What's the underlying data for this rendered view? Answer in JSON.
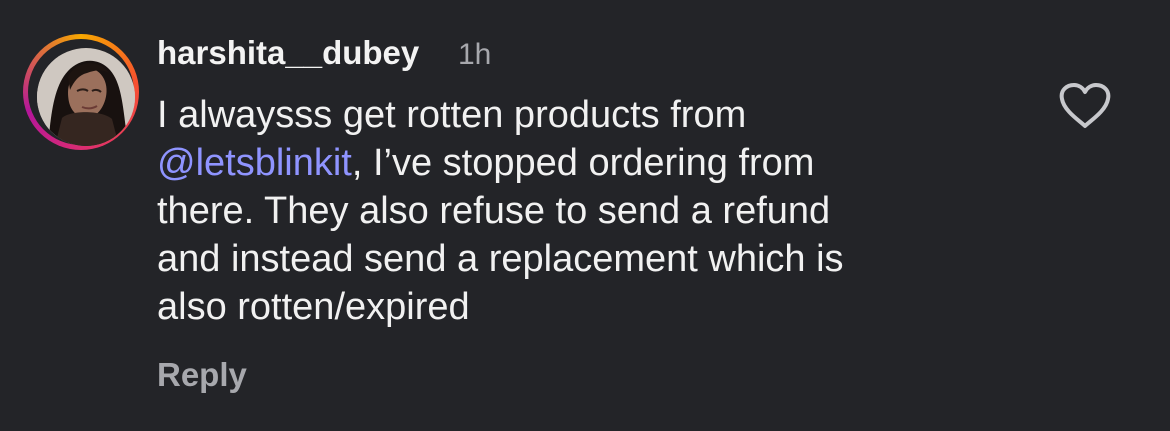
{
  "comment": {
    "username": "harshita__dubey",
    "time": "1h",
    "text_before_mention": "I alwaysss get rotten products from",
    "mention": "@letsblinkit",
    "text_after_mention": ", I’ve stopped ordering from",
    "line_3": "there. They also refuse to send a refund",
    "line_4": "and instead send a replacement which is",
    "line_5": "also rotten/expired",
    "reply_label": "Reply",
    "like_icon": "heart-outline-icon",
    "avatar_icon": "profile-avatar",
    "colors": {
      "background": "#232428",
      "primary_text": "#f1f1f1",
      "secondary_text": "#a7a8ad",
      "mention": "#8f94ff"
    }
  }
}
